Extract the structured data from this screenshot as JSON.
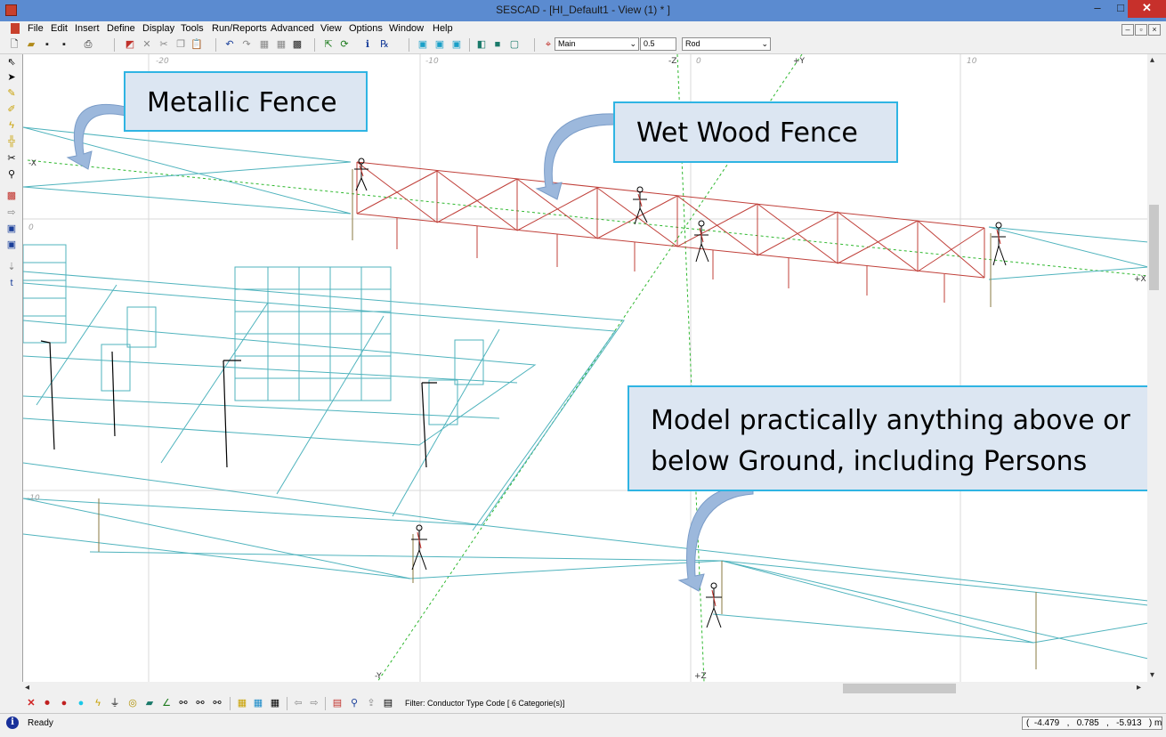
{
  "window": {
    "title": "SESCAD - [HI_Default1 - View (1)  * ]",
    "controls": {
      "minimize": "–",
      "maximize": "□",
      "close": "✕"
    }
  },
  "menu": [
    "File",
    "Edit",
    "Insert",
    "Define",
    "Display",
    "Tools",
    "Run/Reports",
    "Advanced",
    "View",
    "Options",
    "Window",
    "Help"
  ],
  "toolbar": {
    "group_combo": "Main",
    "radius_value": "0.5",
    "type_combo": "Rod"
  },
  "viewport": {
    "axis_labels": [
      "-20",
      "-10",
      "-Z",
      "0",
      "+Y",
      "10",
      "-X",
      "0",
      "-10",
      "+X",
      "-Y",
      "+Z"
    ]
  },
  "callouts": {
    "metallic_fence": "Metallic Fence",
    "wet_wood_fence": "Wet Wood Fence",
    "model_line1": "Model practically anything above or",
    "model_line2": "below Ground, including Persons"
  },
  "filter_text": "Filter: Conductor Type Code [ 6 Categorie(s)]",
  "status": {
    "ready": "Ready",
    "coords": "(  -4.479   ,   0.785   ,   -5.913   ) m"
  },
  "colors": {
    "title_bar": "#5b8bd0",
    "metal_lines": "#4fb3bd",
    "wood_fence": "#c0403a",
    "axis_green": "#2fb82f",
    "callout_bg": "#dce6f2",
    "callout_border": "#2fb4e3"
  },
  "icons": [
    "new-file-icon",
    "open-folder-icon",
    "save-icon",
    "save-all-icon",
    "print-icon",
    "select-icon",
    "delete-icon",
    "cut-icon",
    "copy-icon",
    "paste-icon",
    "undo-icon",
    "redo-icon",
    "zoom-icon",
    "info-icon",
    "arrow-icon",
    "pencil-icon",
    "lightning-icon",
    "person-icon"
  ]
}
